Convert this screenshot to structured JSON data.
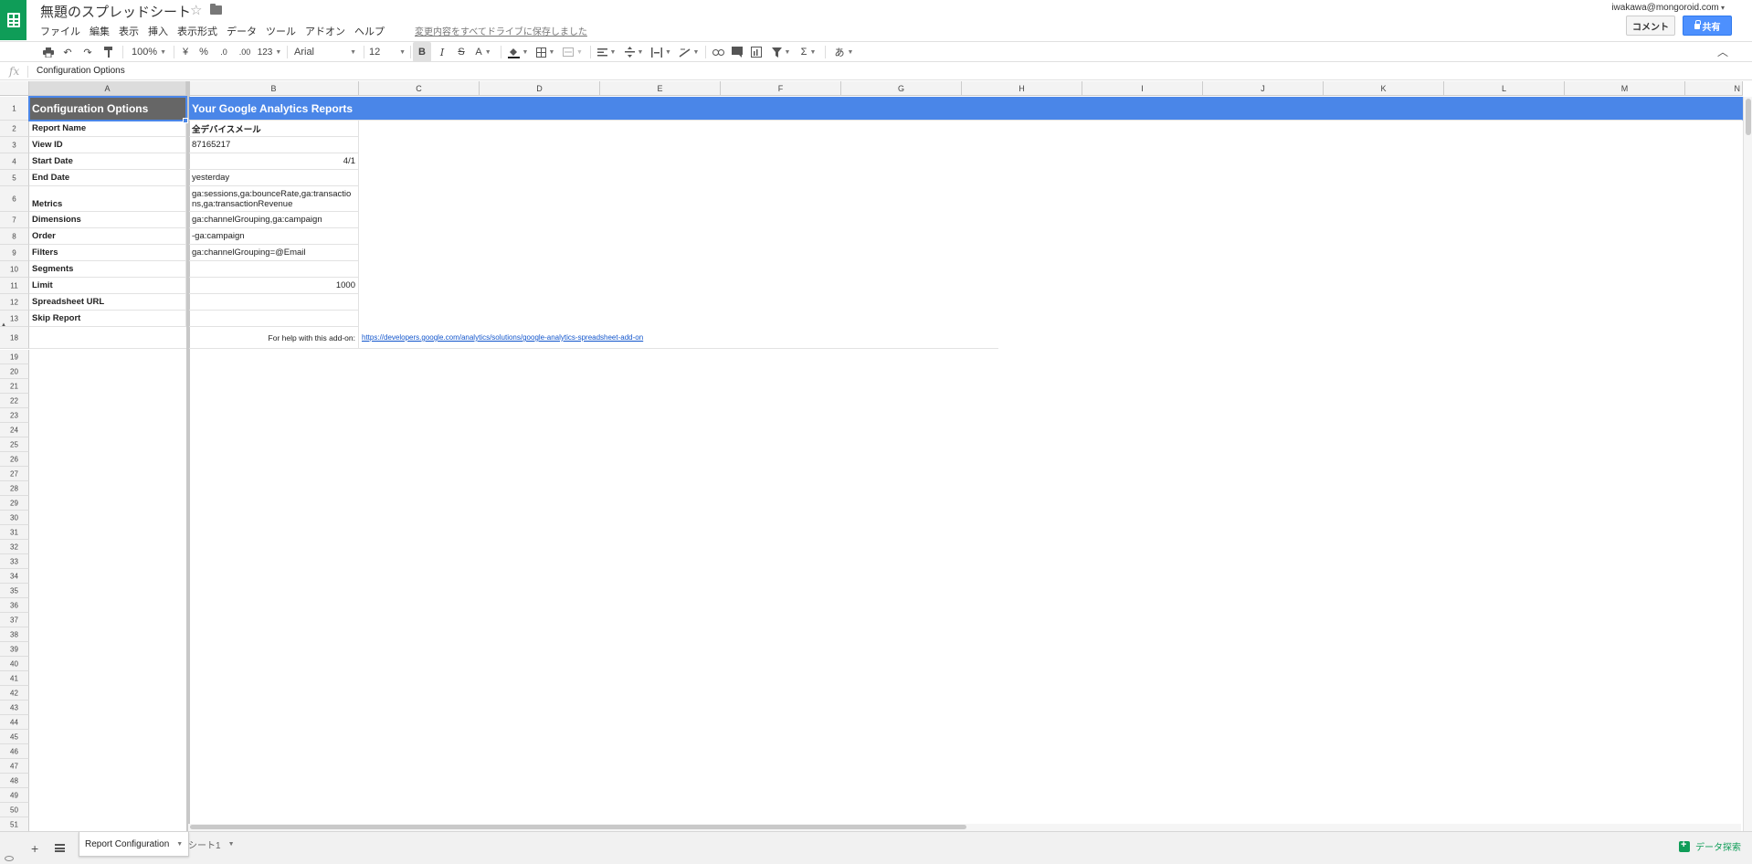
{
  "header": {
    "doc_title": "無題のスプレッドシート",
    "menus": [
      "ファイル",
      "編集",
      "表示",
      "挿入",
      "表示形式",
      "データ",
      "ツール",
      "アドオン",
      "ヘルプ"
    ],
    "save_status": "変更内容をすべてドライブに保存しました",
    "user_email": "iwakawa@mongoroid.com",
    "comment_label": "コメント",
    "share_label": "共有"
  },
  "toolbar": {
    "zoom": "100%",
    "currency": "¥",
    "percent": "%",
    "dec_decrease": ".0",
    "dec_increase": ".00",
    "more_formats": "123",
    "font": "Arial",
    "font_size": "12",
    "bold": "B",
    "italic": "I",
    "strike": "S",
    "text_color": "A",
    "functions": "Σ",
    "input_tools": "あ"
  },
  "formula_bar": {
    "fx": "fx",
    "content": "Configuration Options"
  },
  "columns": [
    "A",
    "B",
    "C",
    "D",
    "E",
    "F",
    "G",
    "H",
    "I",
    "J",
    "K",
    "L",
    "M",
    "N"
  ],
  "rows": {
    "r1": {
      "num": "1",
      "a": "Configuration Options",
      "b": "Your Google Analytics Reports"
    },
    "r2": {
      "num": "2",
      "a": "Report Name",
      "b": "全デバイスメール"
    },
    "r3": {
      "num": "3",
      "a": "View ID",
      "b": "87165217"
    },
    "r4": {
      "num": "4",
      "a": "Start Date",
      "b": "4/1"
    },
    "r5": {
      "num": "5",
      "a": "End Date",
      "b": "yesterday"
    },
    "r6": {
      "num": "6",
      "a": "Metrics",
      "b": "ga:sessions,ga:bounceRate,ga:transactions,ga:transactionRevenue"
    },
    "r7": {
      "num": "7",
      "a": "Dimensions",
      "b": "ga:channelGrouping,ga:campaign"
    },
    "r8": {
      "num": "8",
      "a": "Order",
      "b": "-ga:campaign"
    },
    "r9": {
      "num": "9",
      "a": "Filters",
      "b": "ga:channelGrouping=@Email"
    },
    "r10": {
      "num": "10",
      "a": "Segments",
      "b": ""
    },
    "r11": {
      "num": "11",
      "a": "Limit",
      "b": "1000"
    },
    "r12": {
      "num": "12",
      "a": "Spreadsheet URL",
      "b": ""
    },
    "r13": {
      "num": "13",
      "a": "Skip Report",
      "b": ""
    },
    "r18": {
      "num": "18",
      "b": "For help with this add-on:",
      "c": "https://developers.google.com/analytics/solutions/google-analytics-spreadsheet-add-on"
    }
  },
  "empty_row_numbers": [
    "19",
    "20",
    "21",
    "22",
    "23",
    "24",
    "25",
    "26",
    "27",
    "28",
    "29",
    "30",
    "31",
    "32",
    "33",
    "34",
    "35",
    "36",
    "37",
    "38",
    "39",
    "40",
    "41",
    "42",
    "43",
    "44",
    "45",
    "46",
    "47",
    "48",
    "49",
    "50",
    "51"
  ],
  "sheets": {
    "active": "Report Configuration",
    "other": "シート1"
  },
  "explore_label": "データ探索",
  "colors": {
    "sheets_green": "#0f9d58",
    "header_blue": "#4a86e8",
    "header_gray": "#666666",
    "share_blue": "#4d90fe"
  }
}
